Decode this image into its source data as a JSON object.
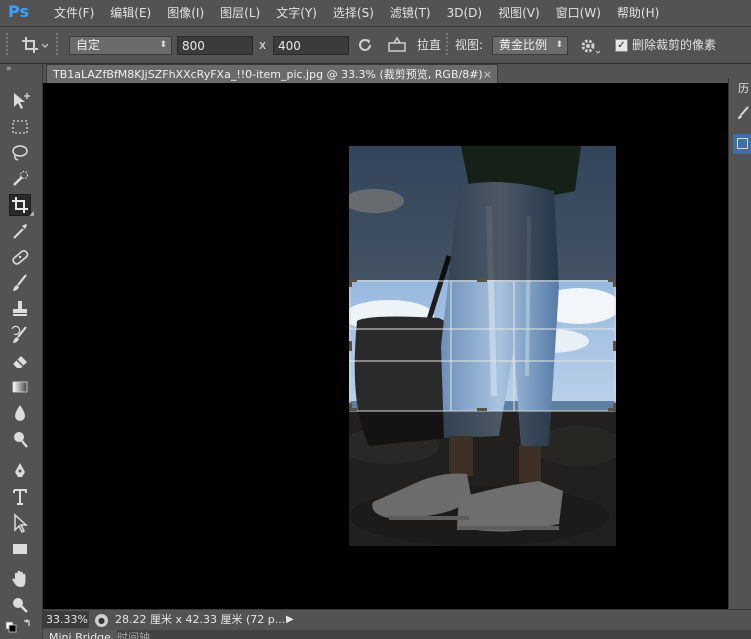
{
  "app": {
    "logo": "Ps",
    "menus": [
      "文件(F)",
      "编辑(E)",
      "图像(I)",
      "图层(L)",
      "文字(Y)",
      "选择(S)",
      "滤镜(T)",
      "3D(D)",
      "视图(V)",
      "窗口(W)",
      "帮助(H)"
    ]
  },
  "options": {
    "ratio_select": "自定",
    "width_value": "800",
    "times_sign": "x",
    "height_value": "400",
    "straighten_label": "拉直",
    "view_label": "视图:",
    "view_select": "黄金比例",
    "delete_cropped_label": "删除裁剪的像素",
    "delete_cropped_checked": true
  },
  "document": {
    "tab_title": "TB1aLAZfBfM8KJjSZFhXXcRyFXa_!!0-item_pic.jpg @ 33.3% (裁剪预览, RGB/8#)",
    "close_glyph": "×"
  },
  "right_panel": {
    "tab_label": "历"
  },
  "status": {
    "zoom": "33.33%",
    "doc_info": "28.22 厘米 x 42.33 厘米 (72 p...",
    "arrow": "▶"
  },
  "bottom_tabs": [
    "Mini Bridge",
    "时间轴"
  ],
  "colors": {
    "ui_gray": "#535353",
    "canvas_black": "#000000",
    "logo_blue": "#39a0ff",
    "guide_white": "#e6e6e6"
  }
}
